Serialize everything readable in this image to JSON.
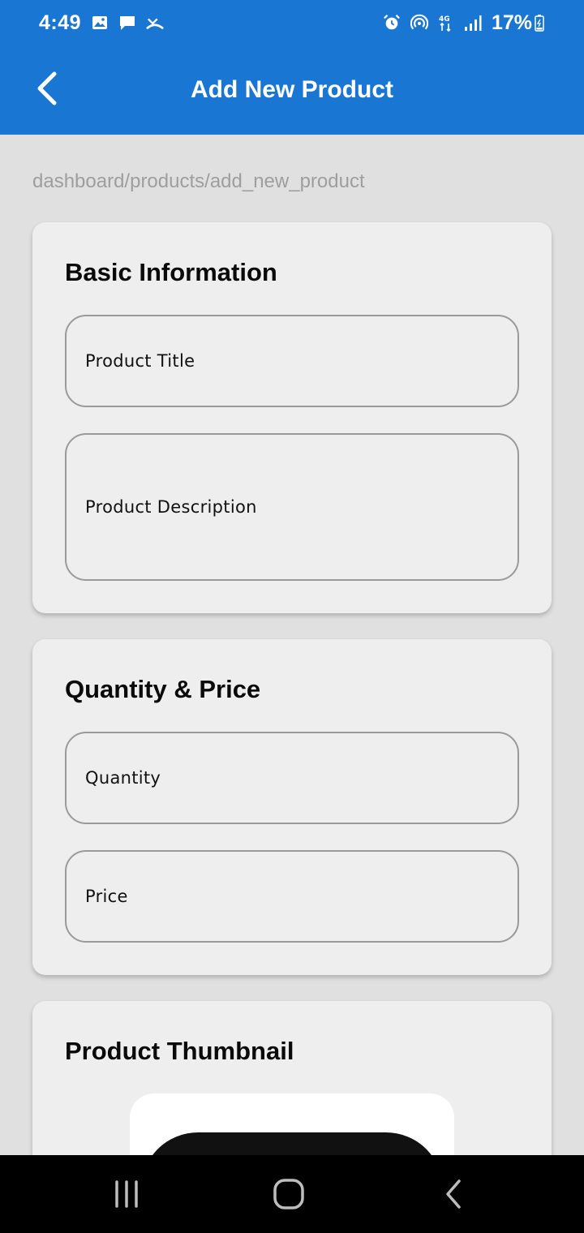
{
  "status_bar": {
    "time": "4:49",
    "battery": "17%",
    "network": "4G",
    "left_icons": [
      "image-icon",
      "message-icon",
      "missed-call-icon"
    ],
    "right_icons": [
      "alarm-icon",
      "hotspot-icon",
      "network-icon",
      "signal-icon",
      "battery-icon"
    ]
  },
  "app_bar": {
    "title": "Add New Product",
    "back_icon": "chevron-left-icon",
    "background_color": "#1976d2"
  },
  "breadcrumb": "dashboard/products/add_new_product",
  "sections": {
    "basic": {
      "title": "Basic Information",
      "fields": {
        "title_label": "Product Title",
        "description_label": "Product Description"
      }
    },
    "quantity_price": {
      "title": "Quantity & Price",
      "fields": {
        "quantity_label": "Quantity",
        "price_label": "Price"
      }
    },
    "thumbnail": {
      "title": "Product Thumbnail"
    }
  },
  "nav_bar": {
    "icons": [
      "recent-apps-icon",
      "home-icon",
      "back-icon"
    ]
  }
}
